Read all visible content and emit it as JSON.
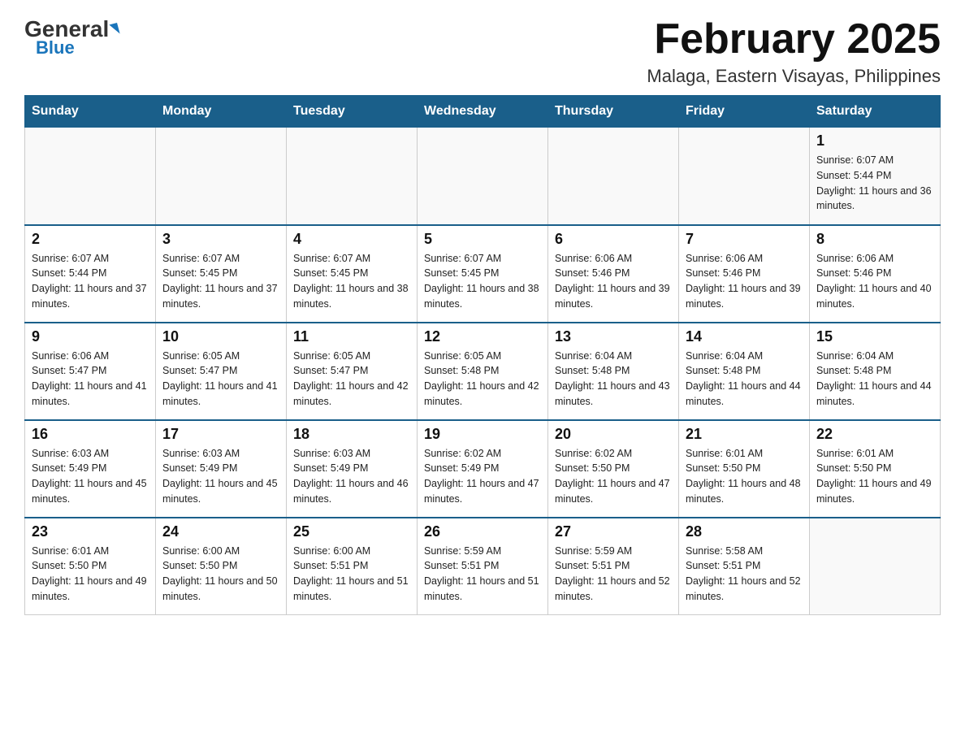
{
  "header": {
    "logo_general": "General",
    "logo_blue": "Blue",
    "title": "February 2025",
    "subtitle": "Malaga, Eastern Visayas, Philippines"
  },
  "days_of_week": [
    "Sunday",
    "Monday",
    "Tuesday",
    "Wednesday",
    "Thursday",
    "Friday",
    "Saturday"
  ],
  "weeks": [
    [
      {
        "day": "",
        "info": ""
      },
      {
        "day": "",
        "info": ""
      },
      {
        "day": "",
        "info": ""
      },
      {
        "day": "",
        "info": ""
      },
      {
        "day": "",
        "info": ""
      },
      {
        "day": "",
        "info": ""
      },
      {
        "day": "1",
        "info": "Sunrise: 6:07 AM\nSunset: 5:44 PM\nDaylight: 11 hours and 36 minutes."
      }
    ],
    [
      {
        "day": "2",
        "info": "Sunrise: 6:07 AM\nSunset: 5:44 PM\nDaylight: 11 hours and 37 minutes."
      },
      {
        "day": "3",
        "info": "Sunrise: 6:07 AM\nSunset: 5:45 PM\nDaylight: 11 hours and 37 minutes."
      },
      {
        "day": "4",
        "info": "Sunrise: 6:07 AM\nSunset: 5:45 PM\nDaylight: 11 hours and 38 minutes."
      },
      {
        "day": "5",
        "info": "Sunrise: 6:07 AM\nSunset: 5:45 PM\nDaylight: 11 hours and 38 minutes."
      },
      {
        "day": "6",
        "info": "Sunrise: 6:06 AM\nSunset: 5:46 PM\nDaylight: 11 hours and 39 minutes."
      },
      {
        "day": "7",
        "info": "Sunrise: 6:06 AM\nSunset: 5:46 PM\nDaylight: 11 hours and 39 minutes."
      },
      {
        "day": "8",
        "info": "Sunrise: 6:06 AM\nSunset: 5:46 PM\nDaylight: 11 hours and 40 minutes."
      }
    ],
    [
      {
        "day": "9",
        "info": "Sunrise: 6:06 AM\nSunset: 5:47 PM\nDaylight: 11 hours and 41 minutes."
      },
      {
        "day": "10",
        "info": "Sunrise: 6:05 AM\nSunset: 5:47 PM\nDaylight: 11 hours and 41 minutes."
      },
      {
        "day": "11",
        "info": "Sunrise: 6:05 AM\nSunset: 5:47 PM\nDaylight: 11 hours and 42 minutes."
      },
      {
        "day": "12",
        "info": "Sunrise: 6:05 AM\nSunset: 5:48 PM\nDaylight: 11 hours and 42 minutes."
      },
      {
        "day": "13",
        "info": "Sunrise: 6:04 AM\nSunset: 5:48 PM\nDaylight: 11 hours and 43 minutes."
      },
      {
        "day": "14",
        "info": "Sunrise: 6:04 AM\nSunset: 5:48 PM\nDaylight: 11 hours and 44 minutes."
      },
      {
        "day": "15",
        "info": "Sunrise: 6:04 AM\nSunset: 5:48 PM\nDaylight: 11 hours and 44 minutes."
      }
    ],
    [
      {
        "day": "16",
        "info": "Sunrise: 6:03 AM\nSunset: 5:49 PM\nDaylight: 11 hours and 45 minutes."
      },
      {
        "day": "17",
        "info": "Sunrise: 6:03 AM\nSunset: 5:49 PM\nDaylight: 11 hours and 45 minutes."
      },
      {
        "day": "18",
        "info": "Sunrise: 6:03 AM\nSunset: 5:49 PM\nDaylight: 11 hours and 46 minutes."
      },
      {
        "day": "19",
        "info": "Sunrise: 6:02 AM\nSunset: 5:49 PM\nDaylight: 11 hours and 47 minutes."
      },
      {
        "day": "20",
        "info": "Sunrise: 6:02 AM\nSunset: 5:50 PM\nDaylight: 11 hours and 47 minutes."
      },
      {
        "day": "21",
        "info": "Sunrise: 6:01 AM\nSunset: 5:50 PM\nDaylight: 11 hours and 48 minutes."
      },
      {
        "day": "22",
        "info": "Sunrise: 6:01 AM\nSunset: 5:50 PM\nDaylight: 11 hours and 49 minutes."
      }
    ],
    [
      {
        "day": "23",
        "info": "Sunrise: 6:01 AM\nSunset: 5:50 PM\nDaylight: 11 hours and 49 minutes."
      },
      {
        "day": "24",
        "info": "Sunrise: 6:00 AM\nSunset: 5:50 PM\nDaylight: 11 hours and 50 minutes."
      },
      {
        "day": "25",
        "info": "Sunrise: 6:00 AM\nSunset: 5:51 PM\nDaylight: 11 hours and 51 minutes."
      },
      {
        "day": "26",
        "info": "Sunrise: 5:59 AM\nSunset: 5:51 PM\nDaylight: 11 hours and 51 minutes."
      },
      {
        "day": "27",
        "info": "Sunrise: 5:59 AM\nSunset: 5:51 PM\nDaylight: 11 hours and 52 minutes."
      },
      {
        "day": "28",
        "info": "Sunrise: 5:58 AM\nSunset: 5:51 PM\nDaylight: 11 hours and 52 minutes."
      },
      {
        "day": "",
        "info": ""
      }
    ]
  ]
}
